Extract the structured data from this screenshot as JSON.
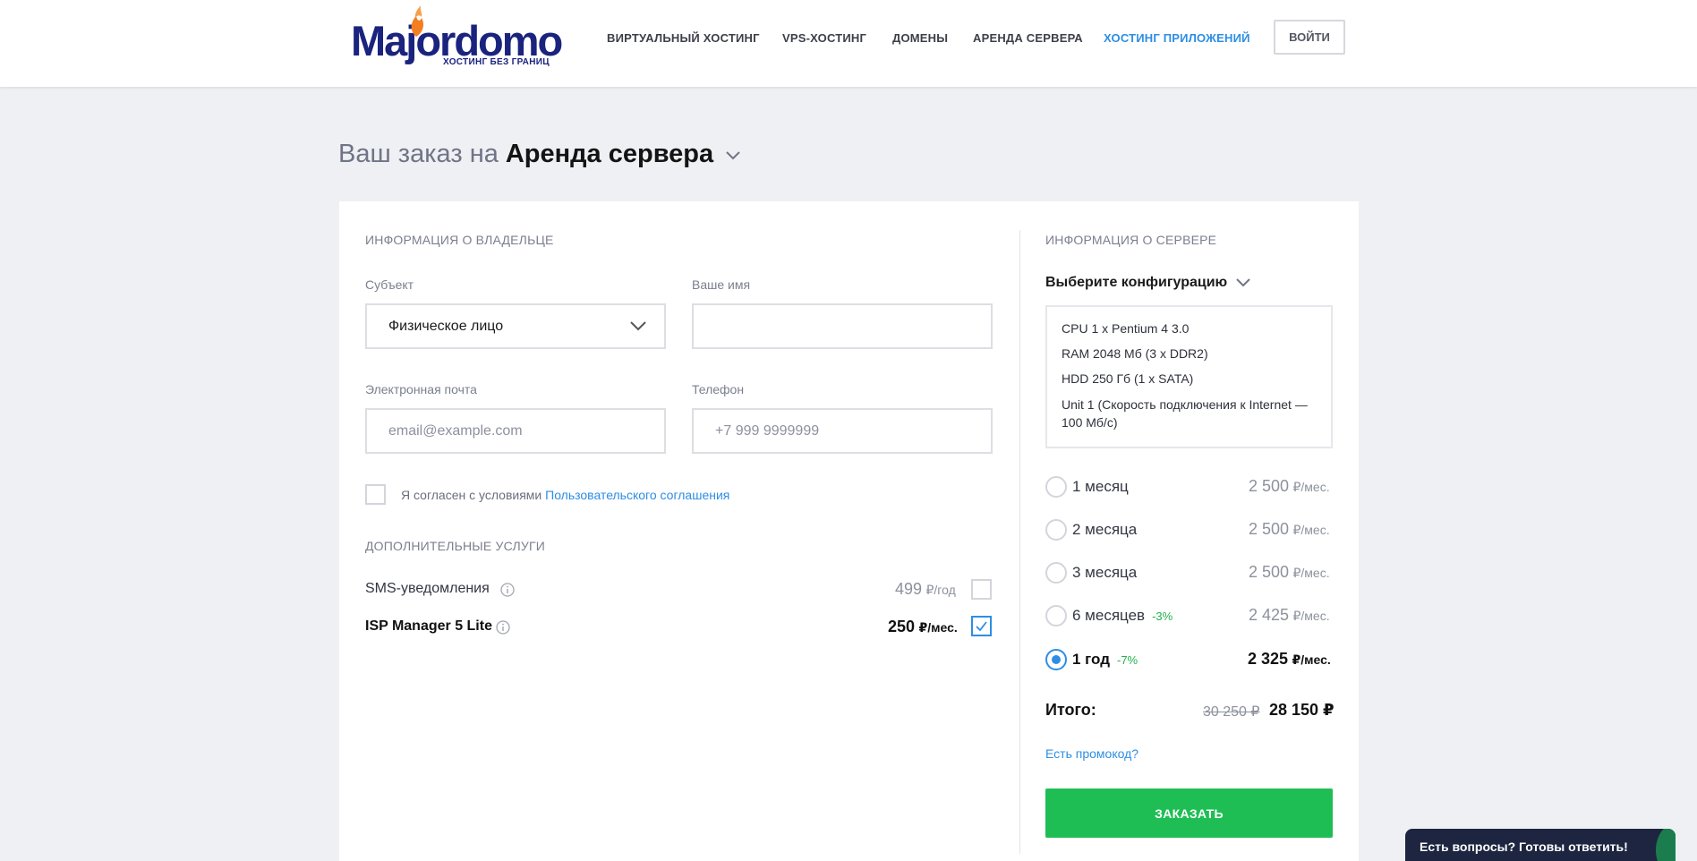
{
  "brand": {
    "logo_text": "Majordomo",
    "tagline": "ХОСТИНГ БЕЗ ГРАНИЦ",
    "brand_color": "#1a237e",
    "flame_color": "#f47e20"
  },
  "nav": {
    "items": [
      {
        "label": "ВИРТУАЛЬНЫЙ ХОСТИНГ",
        "active": false
      },
      {
        "label": "VPS-ХОСТИНГ",
        "active": false
      },
      {
        "label": "ДОМЕНЫ",
        "active": false
      },
      {
        "label": "АРЕНДА СЕРВЕРА",
        "active": false
      },
      {
        "label": "ХОСТИНГ ПРИЛОЖЕНИЙ",
        "active": true
      }
    ],
    "login_label": "ВОЙТИ",
    "active_color": "#2d8ee4"
  },
  "page": {
    "title_prefix": "Ваш заказ на",
    "title_product": "Аренда сервера"
  },
  "owner": {
    "section_title": "ИНФОРМАЦИЯ О ВЛАДЕЛЬЦЕ",
    "subject_label": "Субъект",
    "subject_value": "Физическое лицо",
    "name_label": "Ваше имя",
    "name_value": "",
    "email_label": "Электронная почта",
    "email_placeholder": "email@example.com",
    "phone_label": "Телефон",
    "phone_placeholder": "+7 999 9999999",
    "agree_text": "Я согласен с условиями",
    "agree_link": "Пользовательского соглашения",
    "agree_checked": false
  },
  "extras": {
    "section_title": "ДОПОЛНИТЕЛЬНЫЕ УСЛУГИ",
    "items": [
      {
        "name": "SMS-уведомления",
        "price": "499",
        "unit": "₽/год",
        "checked": false
      },
      {
        "name": "ISP Manager 5 Lite",
        "price": "250",
        "unit": "₽/мес.",
        "checked": true
      }
    ]
  },
  "server": {
    "section_title": "ИНФОРМАЦИЯ О СЕРВЕРЕ",
    "config_label": "Выберите конфигурацию",
    "specs": [
      "CPU 1 x Pentium 4 3.0",
      "RAM 2048 Мб (3 x DDR2)",
      "HDD 250 Гб (1 x SATA)",
      "Unit 1 (Скорость подключения к Internet — 100 Мб/с)"
    ],
    "periods": [
      {
        "label": "1 месяц",
        "discount": "",
        "price": "2 500",
        "unit": "₽/мес.",
        "selected": false
      },
      {
        "label": "2 месяца",
        "discount": "",
        "price": "2 500",
        "unit": "₽/мес.",
        "selected": false
      },
      {
        "label": "3 месяца",
        "discount": "",
        "price": "2 500",
        "unit": "₽/мес.",
        "selected": false
      },
      {
        "label": "6 месяцев",
        "discount": "-3%",
        "price": "2 425",
        "unit": "₽/мес.",
        "selected": false
      },
      {
        "label": "1 год",
        "discount": "-7%",
        "price": "2 325",
        "unit": "₽/мес.",
        "selected": true
      }
    ],
    "total_label": "Итого:",
    "total_old": "30 250 ₽",
    "total_new": "28 150 ₽",
    "promo_label": "Есть промокод?",
    "order_label": "ЗАКАЗАТЬ",
    "order_color": "#1fbe54",
    "discount_color": "#22b24c"
  },
  "chat": {
    "label": "Есть вопросы? Готовы ответить!"
  }
}
